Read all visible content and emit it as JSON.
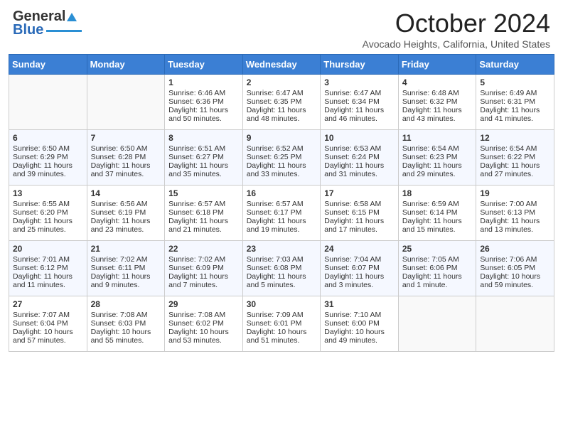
{
  "header": {
    "logo_general": "General",
    "logo_blue": "Blue",
    "month_title": "October 2024",
    "location": "Avocado Heights, California, United States"
  },
  "days_of_week": [
    "Sunday",
    "Monday",
    "Tuesday",
    "Wednesday",
    "Thursday",
    "Friday",
    "Saturday"
  ],
  "weeks": [
    [
      {
        "day": "",
        "sunrise": "",
        "sunset": "",
        "daylight": ""
      },
      {
        "day": "",
        "sunrise": "",
        "sunset": "",
        "daylight": ""
      },
      {
        "day": "1",
        "sunrise": "Sunrise: 6:46 AM",
        "sunset": "Sunset: 6:36 PM",
        "daylight": "Daylight: 11 hours and 50 minutes."
      },
      {
        "day": "2",
        "sunrise": "Sunrise: 6:47 AM",
        "sunset": "Sunset: 6:35 PM",
        "daylight": "Daylight: 11 hours and 48 minutes."
      },
      {
        "day": "3",
        "sunrise": "Sunrise: 6:47 AM",
        "sunset": "Sunset: 6:34 PM",
        "daylight": "Daylight: 11 hours and 46 minutes."
      },
      {
        "day": "4",
        "sunrise": "Sunrise: 6:48 AM",
        "sunset": "Sunset: 6:32 PM",
        "daylight": "Daylight: 11 hours and 43 minutes."
      },
      {
        "day": "5",
        "sunrise": "Sunrise: 6:49 AM",
        "sunset": "Sunset: 6:31 PM",
        "daylight": "Daylight: 11 hours and 41 minutes."
      }
    ],
    [
      {
        "day": "6",
        "sunrise": "Sunrise: 6:50 AM",
        "sunset": "Sunset: 6:29 PM",
        "daylight": "Daylight: 11 hours and 39 minutes."
      },
      {
        "day": "7",
        "sunrise": "Sunrise: 6:50 AM",
        "sunset": "Sunset: 6:28 PM",
        "daylight": "Daylight: 11 hours and 37 minutes."
      },
      {
        "day": "8",
        "sunrise": "Sunrise: 6:51 AM",
        "sunset": "Sunset: 6:27 PM",
        "daylight": "Daylight: 11 hours and 35 minutes."
      },
      {
        "day": "9",
        "sunrise": "Sunrise: 6:52 AM",
        "sunset": "Sunset: 6:25 PM",
        "daylight": "Daylight: 11 hours and 33 minutes."
      },
      {
        "day": "10",
        "sunrise": "Sunrise: 6:53 AM",
        "sunset": "Sunset: 6:24 PM",
        "daylight": "Daylight: 11 hours and 31 minutes."
      },
      {
        "day": "11",
        "sunrise": "Sunrise: 6:54 AM",
        "sunset": "Sunset: 6:23 PM",
        "daylight": "Daylight: 11 hours and 29 minutes."
      },
      {
        "day": "12",
        "sunrise": "Sunrise: 6:54 AM",
        "sunset": "Sunset: 6:22 PM",
        "daylight": "Daylight: 11 hours and 27 minutes."
      }
    ],
    [
      {
        "day": "13",
        "sunrise": "Sunrise: 6:55 AM",
        "sunset": "Sunset: 6:20 PM",
        "daylight": "Daylight: 11 hours and 25 minutes."
      },
      {
        "day": "14",
        "sunrise": "Sunrise: 6:56 AM",
        "sunset": "Sunset: 6:19 PM",
        "daylight": "Daylight: 11 hours and 23 minutes."
      },
      {
        "day": "15",
        "sunrise": "Sunrise: 6:57 AM",
        "sunset": "Sunset: 6:18 PM",
        "daylight": "Daylight: 11 hours and 21 minutes."
      },
      {
        "day": "16",
        "sunrise": "Sunrise: 6:57 AM",
        "sunset": "Sunset: 6:17 PM",
        "daylight": "Daylight: 11 hours and 19 minutes."
      },
      {
        "day": "17",
        "sunrise": "Sunrise: 6:58 AM",
        "sunset": "Sunset: 6:15 PM",
        "daylight": "Daylight: 11 hours and 17 minutes."
      },
      {
        "day": "18",
        "sunrise": "Sunrise: 6:59 AM",
        "sunset": "Sunset: 6:14 PM",
        "daylight": "Daylight: 11 hours and 15 minutes."
      },
      {
        "day": "19",
        "sunrise": "Sunrise: 7:00 AM",
        "sunset": "Sunset: 6:13 PM",
        "daylight": "Daylight: 11 hours and 13 minutes."
      }
    ],
    [
      {
        "day": "20",
        "sunrise": "Sunrise: 7:01 AM",
        "sunset": "Sunset: 6:12 PM",
        "daylight": "Daylight: 11 hours and 11 minutes."
      },
      {
        "day": "21",
        "sunrise": "Sunrise: 7:02 AM",
        "sunset": "Sunset: 6:11 PM",
        "daylight": "Daylight: 11 hours and 9 minutes."
      },
      {
        "day": "22",
        "sunrise": "Sunrise: 7:02 AM",
        "sunset": "Sunset: 6:09 PM",
        "daylight": "Daylight: 11 hours and 7 minutes."
      },
      {
        "day": "23",
        "sunrise": "Sunrise: 7:03 AM",
        "sunset": "Sunset: 6:08 PM",
        "daylight": "Daylight: 11 hours and 5 minutes."
      },
      {
        "day": "24",
        "sunrise": "Sunrise: 7:04 AM",
        "sunset": "Sunset: 6:07 PM",
        "daylight": "Daylight: 11 hours and 3 minutes."
      },
      {
        "day": "25",
        "sunrise": "Sunrise: 7:05 AM",
        "sunset": "Sunset: 6:06 PM",
        "daylight": "Daylight: 11 hours and 1 minute."
      },
      {
        "day": "26",
        "sunrise": "Sunrise: 7:06 AM",
        "sunset": "Sunset: 6:05 PM",
        "daylight": "Daylight: 10 hours and 59 minutes."
      }
    ],
    [
      {
        "day": "27",
        "sunrise": "Sunrise: 7:07 AM",
        "sunset": "Sunset: 6:04 PM",
        "daylight": "Daylight: 10 hours and 57 minutes."
      },
      {
        "day": "28",
        "sunrise": "Sunrise: 7:08 AM",
        "sunset": "Sunset: 6:03 PM",
        "daylight": "Daylight: 10 hours and 55 minutes."
      },
      {
        "day": "29",
        "sunrise": "Sunrise: 7:08 AM",
        "sunset": "Sunset: 6:02 PM",
        "daylight": "Daylight: 10 hours and 53 minutes."
      },
      {
        "day": "30",
        "sunrise": "Sunrise: 7:09 AM",
        "sunset": "Sunset: 6:01 PM",
        "daylight": "Daylight: 10 hours and 51 minutes."
      },
      {
        "day": "31",
        "sunrise": "Sunrise: 7:10 AM",
        "sunset": "Sunset: 6:00 PM",
        "daylight": "Daylight: 10 hours and 49 minutes."
      },
      {
        "day": "",
        "sunrise": "",
        "sunset": "",
        "daylight": ""
      },
      {
        "day": "",
        "sunrise": "",
        "sunset": "",
        "daylight": ""
      }
    ]
  ]
}
